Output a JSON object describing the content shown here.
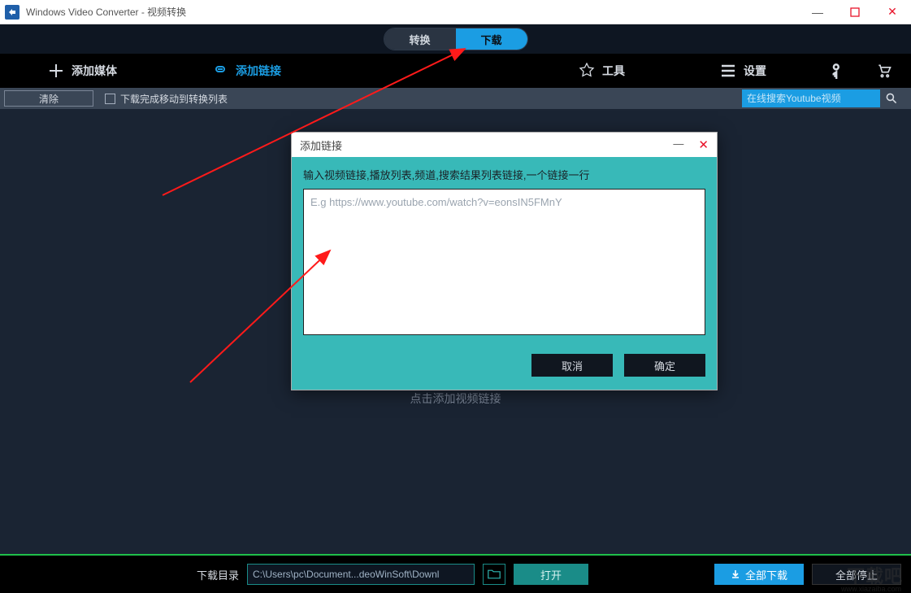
{
  "window": {
    "title": "Windows Video Converter - 视频转换"
  },
  "mode": {
    "convert": "转换",
    "download": "下载"
  },
  "toolbar": {
    "add_media": "添加媒体",
    "add_link": "添加链接",
    "tools": "工具",
    "settings": "设置"
  },
  "subbar": {
    "clear": "清除",
    "move_after_dl": "下载完成移动到转换列表",
    "search_placeholder": "在线搜索Youtube视频"
  },
  "main": {
    "hint": "点击添加视频链接"
  },
  "dialog": {
    "title": "添加链接",
    "note": "输入视频链接,播放列表,频道,搜索结果列表链接,一个链接一行",
    "placeholder": "E.g https://www.youtube.com/watch?v=eonsIN5FMnY",
    "cancel": "取消",
    "ok": "确定"
  },
  "bottom": {
    "label": "下载目录",
    "path": "C:\\Users\\pc\\Document...deoWinSoft\\Downl",
    "open": "打开",
    "download_all": "全部下载",
    "stop_all": "全部停止"
  },
  "watermark": {
    "text": "下载吧",
    "url": "www.xiazaiba.com"
  }
}
